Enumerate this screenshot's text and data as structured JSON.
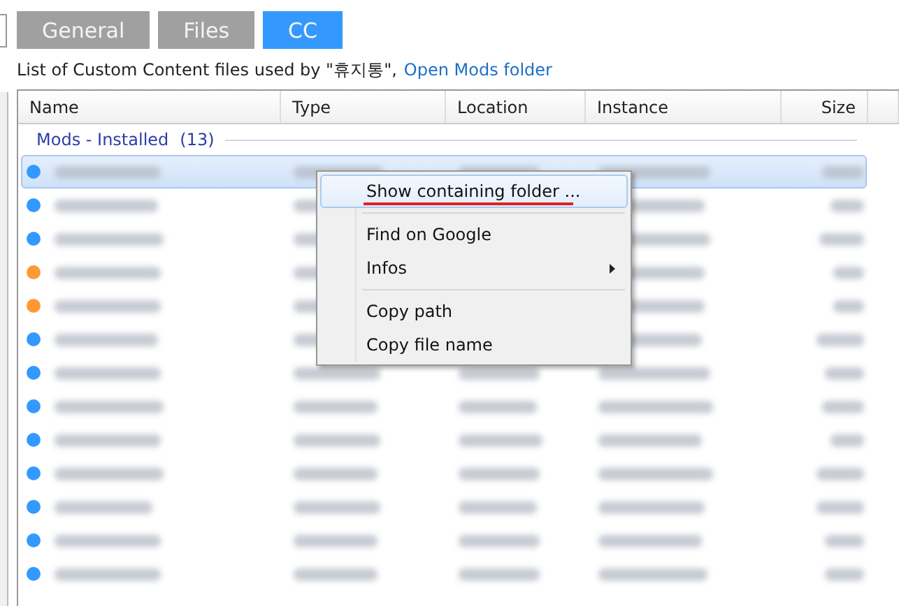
{
  "tabs": [
    {
      "label": "General",
      "selected": false
    },
    {
      "label": "Files",
      "selected": false
    },
    {
      "label": "CC",
      "selected": true
    }
  ],
  "description": {
    "text": "List of Custom Content files used by \"휴지통\",",
    "link": "Open Mods folder"
  },
  "table": {
    "columns": [
      "Name",
      "Type",
      "Location",
      "Instance",
      "Size"
    ],
    "group": {
      "label": "Mods - Installed",
      "count": "(13)"
    },
    "rows": [
      {
        "color": "#3399ff",
        "selected": true
      },
      {
        "color": "#3399ff",
        "selected": false
      },
      {
        "color": "#3399ff",
        "selected": false
      },
      {
        "color": "#ff9933",
        "selected": false
      },
      {
        "color": "#ff9933",
        "selected": false
      },
      {
        "color": "#3399ff",
        "selected": false
      },
      {
        "color": "#3399ff",
        "selected": false
      },
      {
        "color": "#3399ff",
        "selected": false
      },
      {
        "color": "#3399ff",
        "selected": false
      },
      {
        "color": "#3399ff",
        "selected": false
      },
      {
        "color": "#3399ff",
        "selected": false
      },
      {
        "color": "#3399ff",
        "selected": false
      },
      {
        "color": "#3399ff",
        "selected": false
      }
    ]
  },
  "context_menu": {
    "items": [
      {
        "kind": "item",
        "label": "Show containing folder ...",
        "selected": true,
        "underlined": true
      },
      {
        "kind": "separator"
      },
      {
        "kind": "item",
        "label": "Find on Google",
        "selected": false,
        "underlined": false
      },
      {
        "kind": "submenu",
        "label": "Infos",
        "selected": false,
        "underlined": false
      },
      {
        "kind": "separator"
      },
      {
        "kind": "item",
        "label": "Copy path",
        "selected": false,
        "underlined": false
      },
      {
        "kind": "item",
        "label": "Copy file name",
        "selected": false,
        "underlined": false
      }
    ]
  }
}
